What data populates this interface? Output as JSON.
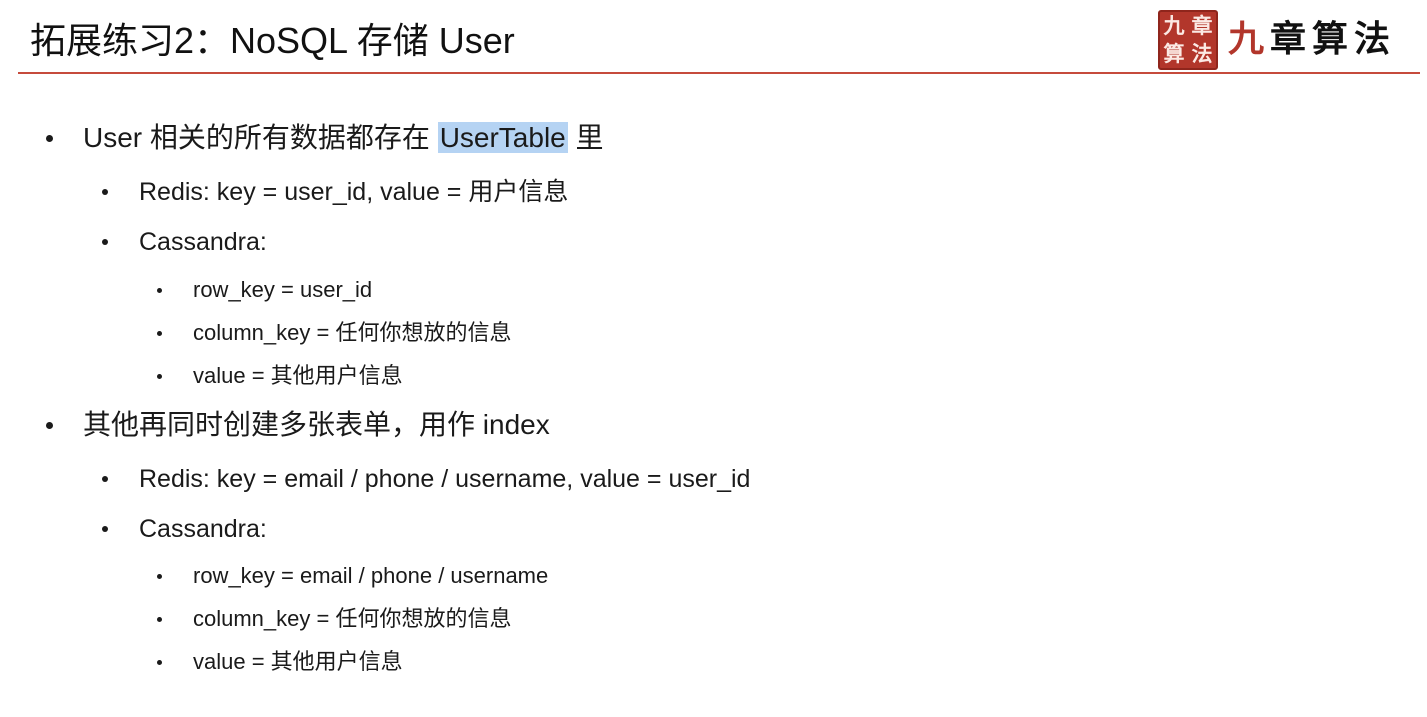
{
  "title": "拓展练习2：NoSQL 存储 User",
  "logo": {
    "seal_chars": [
      "九",
      "章",
      "算",
      "法"
    ],
    "text_first": "九",
    "text_rest": "章算法"
  },
  "sections": [
    {
      "text_before": "User 相关的所有数据都存在 ",
      "highlight": "UserTable",
      "text_after": " 里",
      "redis": "Redis: key = user_id, value = 用户信息",
      "cassandra": "Cassandra:",
      "row_key": "row_key = user_id",
      "column_key": "column_key = 任何你想放的信息",
      "value": "value = 其他用户信息"
    },
    {
      "text": "其他再同时创建多张表单，用作 index",
      "redis": "Redis: key = email / phone / username,  value = user_id",
      "cassandra": "Cassandra:",
      "row_key": "row_key = email / phone / username",
      "column_key": "column_key = 任何你想放的信息",
      "value": "value = 其他用户信息"
    }
  ],
  "colors": {
    "rule": "#c64b3c",
    "highlight": "#b5d3f3",
    "seal": "#b2362b"
  }
}
